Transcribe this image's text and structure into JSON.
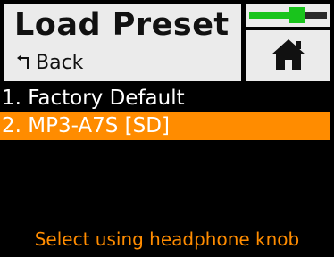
{
  "header": {
    "title": "Load Preset",
    "back_label": "Back",
    "back_icon": "return-arrow-icon",
    "home_icon": "home-icon"
  },
  "level_meter": {
    "level": 0.62,
    "color": "#19c41c"
  },
  "menu": {
    "items": [
      {
        "label": "1. Factory Default",
        "selected": false
      },
      {
        "label": "2. MP3-A7S [SD]",
        "selected": true
      }
    ]
  },
  "hint": "Select using headphone knob",
  "colors": {
    "accent": "#ff8c00",
    "panel": "#ebebeb",
    "background": "#000000",
    "meter": "#19c41c"
  }
}
